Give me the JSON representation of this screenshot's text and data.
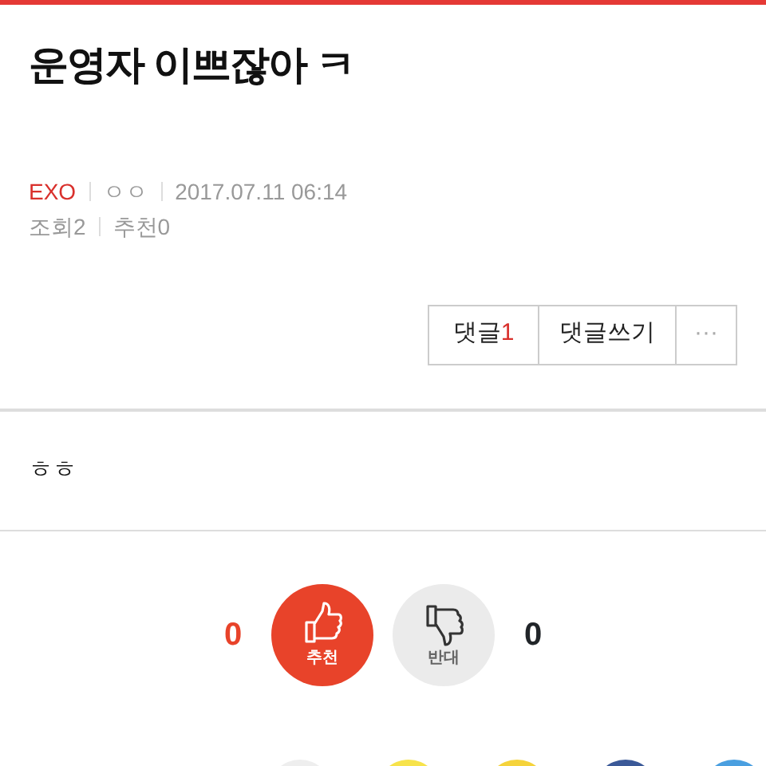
{
  "title": "운영자 이쁘잖아 ㅋ",
  "meta": {
    "board": "EXO",
    "author": "ㅇㅇ",
    "date": "2017.07.11 06:14",
    "views": "조회2",
    "recommends": "추천0"
  },
  "actions": {
    "comments_label": "댓글",
    "comments_count": "1",
    "write": "댓글쓰기",
    "more": "···"
  },
  "body": "ㅎㅎ",
  "vote": {
    "up_count": "0",
    "up_label": "추천",
    "down_label": "반대",
    "down_count": "0"
  },
  "share_buttons": [
    {
      "color": "#eeeeee"
    },
    {
      "color": "#f7e34b"
    },
    {
      "color": "#f5d33b"
    },
    {
      "color": "#3b5998"
    },
    {
      "color": "#4a9fe0"
    }
  ]
}
